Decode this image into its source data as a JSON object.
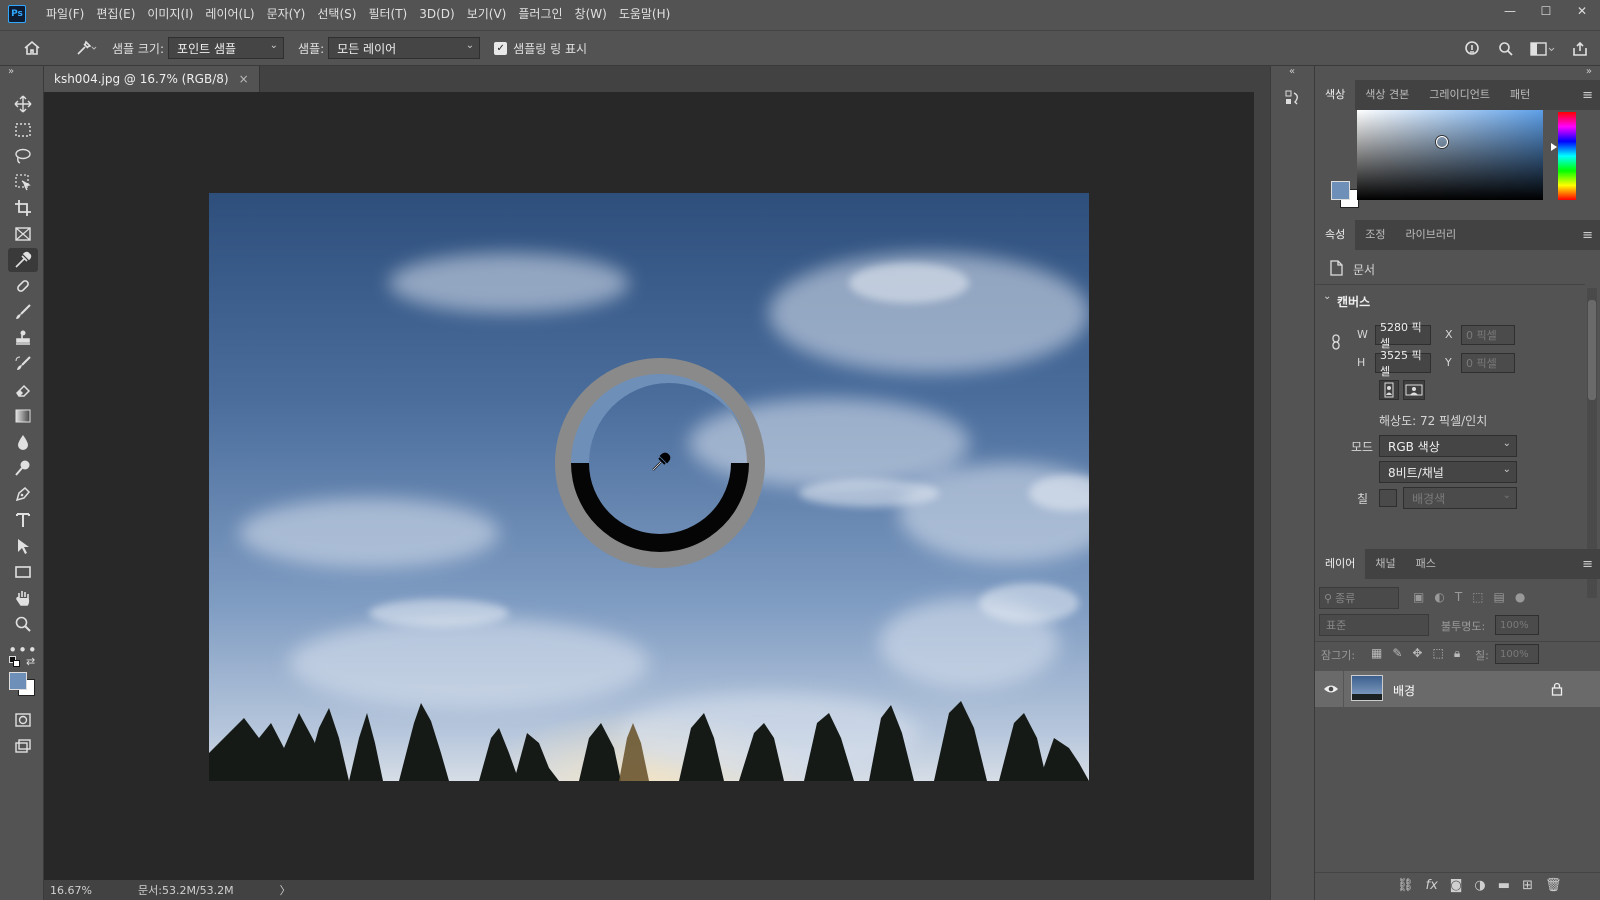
{
  "app": {
    "logo": "Ps"
  },
  "menu": [
    "파일(F)",
    "편집(E)",
    "이미지(I)",
    "레이어(L)",
    "문자(Y)",
    "선택(S)",
    "필터(T)",
    "3D(D)",
    "보기(V)",
    "플러그인",
    "창(W)",
    "도움말(H)"
  ],
  "options": {
    "sample_size_label": "샘플 크기:",
    "sample_size_value": "포인트 샘플",
    "sample_label": "샘플:",
    "sample_value": "모든 레이어",
    "sampling_ring_label": "샘플링 링 표시",
    "sampling_ring_checked": true
  },
  "document": {
    "tab_title": "ksh004.jpg @ 16.7% (RGB/8)",
    "close_glyph": "×",
    "zoom": "16.67%",
    "doc_size": "문서:53.2M/53.2M",
    "status_arrow": "〉"
  },
  "color_panel": {
    "tabs": [
      "색상",
      "색상 견본",
      "그레이디언트",
      "패턴"
    ],
    "active_tab": 0,
    "foreground": "#6d8fb8",
    "background": "#ffffff",
    "field_hue": "#5d9fe8"
  },
  "properties_panel": {
    "tabs": [
      "속성",
      "조정",
      "라이브러리"
    ],
    "active_tab": 0,
    "doc_label": "문서",
    "section_title": "캔버스",
    "w_label": "W",
    "w_value": "5280 픽셀",
    "h_label": "H",
    "h_value": "3525 픽셀",
    "x_label": "X",
    "x_value": "0 픽셀",
    "y_label": "Y",
    "y_value": "0 픽셀",
    "resolution": "해상도: 72 픽셀/인치",
    "mode_label": "모드",
    "mode_value": "RGB 색상",
    "bit_depth": "8비트/채널",
    "fill_label": "칠",
    "fill_value": "배경색"
  },
  "layers_panel": {
    "tabs": [
      "레이어",
      "채널",
      "패스"
    ],
    "active_tab": 0,
    "filter_placeholder": "종류",
    "blend_mode": "표준",
    "opacity_label": "불투명도:",
    "opacity_value": "100%",
    "lock_label": "잠그기:",
    "fill_label": "칠:",
    "fill_value": "100%",
    "layers": [
      {
        "name": "배경",
        "visible": true,
        "locked": true
      }
    ]
  },
  "icons": [
    "home-icon",
    "eyedropper-icon",
    "search-icon",
    "share-icon",
    "move-icon",
    "marquee-icon",
    "lasso-icon",
    "crop-icon",
    "brush-icon",
    "stamp-icon",
    "eraser-icon",
    "gradient-icon",
    "pen-icon",
    "type-icon",
    "hand-icon",
    "zoom-icon",
    "eye-icon",
    "lock-icon",
    "trash-icon"
  ]
}
